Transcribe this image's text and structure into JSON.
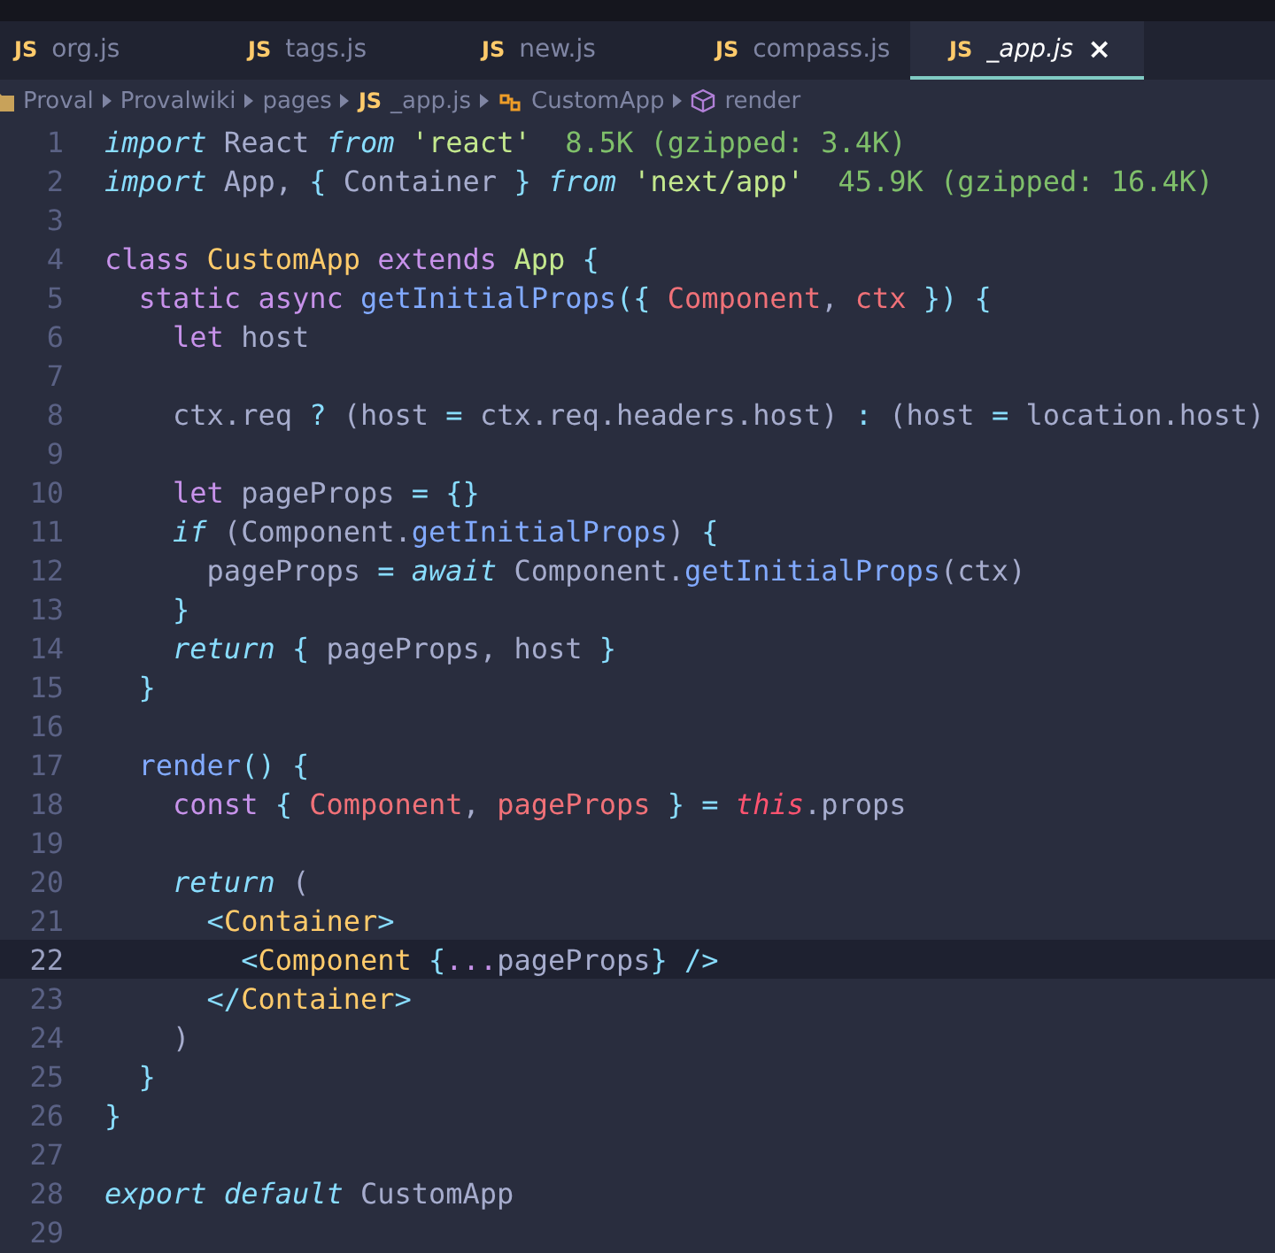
{
  "tabs": [
    {
      "icon": "JS",
      "label": "org.js",
      "selected": false
    },
    {
      "icon": "JS",
      "label": "tags.js",
      "selected": false
    },
    {
      "icon": "JS",
      "label": "new.js",
      "selected": false
    },
    {
      "icon": "JS",
      "label": "compass.js",
      "selected": false
    },
    {
      "icon": "JS",
      "label": "_app.js",
      "selected": true,
      "close": "×"
    }
  ],
  "breadcrumbs": [
    {
      "kind": "folder",
      "label": "Proval"
    },
    {
      "kind": "folder",
      "label": "Provalwiki"
    },
    {
      "kind": "folder",
      "label": "pages"
    },
    {
      "kind": "file",
      "icon": "JS",
      "label": "_app.js"
    },
    {
      "kind": "class",
      "label": "CustomApp"
    },
    {
      "kind": "method",
      "label": "render"
    }
  ],
  "lines": [
    {
      "number": "1",
      "current": false,
      "tokens": [
        {
          "kind": "ikw",
          "text": "import"
        },
        {
          "kind": "plain",
          "text": " React "
        },
        {
          "kind": "ikw",
          "text": "from"
        },
        {
          "kind": "str",
          "text": " 'react'"
        },
        {
          "kind": "hint",
          "text": "  8.5K (gzipped: 3.4K)"
        }
      ]
    },
    {
      "number": "2",
      "current": false,
      "tokens": [
        {
          "kind": "ikw",
          "text": "import"
        },
        {
          "kind": "plain",
          "text": " App, "
        },
        {
          "kind": "punct",
          "text": "{"
        },
        {
          "kind": "plain",
          "text": " Container "
        },
        {
          "kind": "punct",
          "text": "}"
        },
        {
          "kind": "ikw",
          "text": " from"
        },
        {
          "kind": "str",
          "text": " 'next/app'"
        },
        {
          "kind": "hint",
          "text": "  45.9K (gzipped: 16.4K)"
        }
      ]
    },
    {
      "number": "3",
      "current": false
    },
    {
      "number": "4",
      "current": false,
      "tokens": [
        {
          "kind": "kw",
          "text": "class"
        },
        {
          "kind": "cls",
          "text": " CustomApp"
        },
        {
          "kind": "kw",
          "text": " extends"
        },
        {
          "kind": "cls2",
          "text": " App"
        },
        {
          "kind": "punct",
          "text": " {"
        }
      ]
    },
    {
      "number": "5",
      "current": false,
      "tokens": [
        {
          "kind": "kw",
          "text": "  static async"
        },
        {
          "kind": "fn",
          "text": " getInitialProps"
        },
        {
          "kind": "punct",
          "text": "({"
        },
        {
          "kind": "param",
          "text": " Component"
        },
        {
          "kind": "plain",
          "text": ","
        },
        {
          "kind": "param",
          "text": " ctx"
        },
        {
          "kind": "punct",
          "text": " })"
        },
        {
          "kind": "punct",
          "text": " {"
        }
      ]
    },
    {
      "number": "6",
      "current": false,
      "tokens": [
        {
          "kind": "kw",
          "text": "    let"
        },
        {
          "kind": "plain",
          "text": " host"
        }
      ]
    },
    {
      "number": "7",
      "current": false
    },
    {
      "number": "8",
      "current": false,
      "tokens": [
        {
          "kind": "plain",
          "text": "    ctx.req "
        },
        {
          "kind": "punct",
          "text": "?"
        },
        {
          "kind": "plain",
          "text": " (host "
        },
        {
          "kind": "punct",
          "text": "="
        },
        {
          "kind": "plain",
          "text": " ctx.req.headers.host) "
        },
        {
          "kind": "punct",
          "text": ":"
        },
        {
          "kind": "plain",
          "text": " (host "
        },
        {
          "kind": "punct",
          "text": "="
        },
        {
          "kind": "plain",
          "text": " location.host)"
        }
      ]
    },
    {
      "number": "9",
      "current": false
    },
    {
      "number": "10",
      "current": false,
      "tokens": [
        {
          "kind": "kw",
          "text": "    let"
        },
        {
          "kind": "plain",
          "text": " pageProps "
        },
        {
          "kind": "punct",
          "text": "= {}"
        }
      ]
    },
    {
      "number": "11",
      "current": false,
      "tokens": [
        {
          "kind": "ikw",
          "text": "    if"
        },
        {
          "kind": "plain",
          "text": " (Component."
        },
        {
          "kind": "fn",
          "text": "getInitialProps"
        },
        {
          "kind": "plain",
          "text": ") "
        },
        {
          "kind": "punct",
          "text": "{"
        }
      ]
    },
    {
      "number": "12",
      "current": false,
      "tokens": [
        {
          "kind": "plain",
          "text": "      pageProps "
        },
        {
          "kind": "punct",
          "text": "="
        },
        {
          "kind": "ikw",
          "text": " await"
        },
        {
          "kind": "plain",
          "text": " Component."
        },
        {
          "kind": "fn",
          "text": "getInitialProps"
        },
        {
          "kind": "plain",
          "text": "(ctx)"
        }
      ]
    },
    {
      "number": "13",
      "current": false,
      "tokens": [
        {
          "kind": "punct",
          "text": "    }"
        }
      ]
    },
    {
      "number": "14",
      "current": false,
      "tokens": [
        {
          "kind": "ikw",
          "text": "    return"
        },
        {
          "kind": "punct",
          "text": " {"
        },
        {
          "kind": "plain",
          "text": " pageProps, host "
        },
        {
          "kind": "punct",
          "text": "}"
        }
      ]
    },
    {
      "number": "15",
      "current": false,
      "tokens": [
        {
          "kind": "punct",
          "text": "  }"
        }
      ]
    },
    {
      "number": "16",
      "current": false
    },
    {
      "number": "17",
      "current": false,
      "tokens": [
        {
          "kind": "fn",
          "text": "  render"
        },
        {
          "kind": "punct",
          "text": "() {"
        }
      ]
    },
    {
      "number": "18",
      "current": false,
      "tokens": [
        {
          "kind": "kw",
          "text": "    const"
        },
        {
          "kind": "punct",
          "text": " {"
        },
        {
          "kind": "param",
          "text": " Component"
        },
        {
          "kind": "plain",
          "text": ","
        },
        {
          "kind": "param",
          "text": " pageProps"
        },
        {
          "kind": "punct",
          "text": " } ="
        },
        {
          "kind": "this",
          "text": " this"
        },
        {
          "kind": "plain",
          "text": ".props"
        }
      ]
    },
    {
      "number": "19",
      "current": false
    },
    {
      "number": "20",
      "current": false,
      "tokens": [
        {
          "kind": "ikw",
          "text": "    return"
        },
        {
          "kind": "plain",
          "text": " ("
        }
      ]
    },
    {
      "number": "21",
      "current": false,
      "tokens": [
        {
          "kind": "punct",
          "text": "      <"
        },
        {
          "kind": "cls",
          "text": "Container"
        },
        {
          "kind": "punct",
          "text": ">"
        }
      ]
    },
    {
      "number": "22",
      "current": true,
      "tokens": [
        {
          "kind": "punct",
          "text": "        <"
        },
        {
          "kind": "cls",
          "text": "Component"
        },
        {
          "kind": "punct",
          "text": " {"
        },
        {
          "kind": "kw",
          "text": "..."
        },
        {
          "kind": "plain",
          "text": "pageProps"
        },
        {
          "kind": "punct",
          "text": "} />"
        }
      ]
    },
    {
      "number": "23",
      "current": false,
      "tokens": [
        {
          "kind": "punct",
          "text": "      </"
        },
        {
          "kind": "cls",
          "text": "Container"
        },
        {
          "kind": "punct",
          "text": ">"
        }
      ]
    },
    {
      "number": "24",
      "current": false,
      "tokens": [
        {
          "kind": "plain",
          "text": "    )"
        }
      ]
    },
    {
      "number": "25",
      "current": false,
      "tokens": [
        {
          "kind": "punct",
          "text": "  }"
        }
      ]
    },
    {
      "number": "26",
      "current": false,
      "tokens": [
        {
          "kind": "punct",
          "text": "}"
        }
      ]
    },
    {
      "number": "27",
      "current": false
    },
    {
      "number": "28",
      "current": false,
      "tokens": [
        {
          "kind": "ikw",
          "text": "export default"
        },
        {
          "kind": "plain",
          "text": " CustomApp"
        }
      ]
    },
    {
      "number": "29",
      "current": false
    }
  ]
}
